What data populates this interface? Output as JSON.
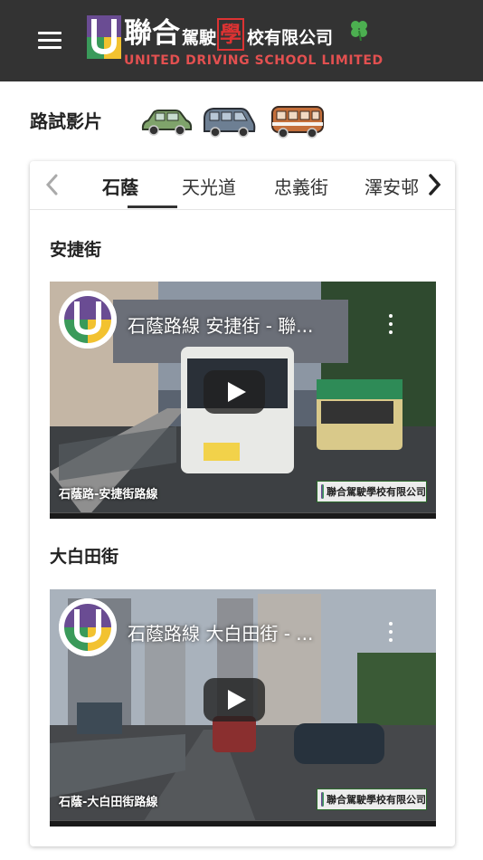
{
  "header": {
    "brand_big": "聯合",
    "brand_small_1": "駕駛",
    "brand_highlight": "學",
    "brand_small_2": "校有限公司",
    "brand_en": "UNITED DRIVING SCHOOL LIMITED",
    "menu_icon": "hamburger-menu-icon",
    "colors": {
      "header_bg": "#333333",
      "brand_en": "#e35050",
      "highlight": "#dd3333",
      "clover": "#4caf50"
    }
  },
  "section": {
    "label": "路試影片",
    "vehicle_icons": [
      "private-car-icon",
      "light-goods-van-icon",
      "light-bus-icon"
    ]
  },
  "tabs": {
    "prev_icon": "chevron-left-icon",
    "next_icon": "chevron-right-icon",
    "items": [
      {
        "label": "石蔭",
        "active": true
      },
      {
        "label": "天光道",
        "active": false
      },
      {
        "label": "忠義街",
        "active": false
      },
      {
        "label": "澤安邨",
        "active": false
      }
    ]
  },
  "videos": [
    {
      "street": "安捷街",
      "title": "石蔭路線 安捷街 - 聯...",
      "caption": "石蔭路-安捷街路線",
      "watermark": "聯合駕駛學校有限公司"
    },
    {
      "street": "大白田街",
      "title": "石蔭路線 大白田街 - ...",
      "caption": "石蔭-大白田街路線",
      "watermark": "聯合駕駛學校有限公司"
    }
  ]
}
